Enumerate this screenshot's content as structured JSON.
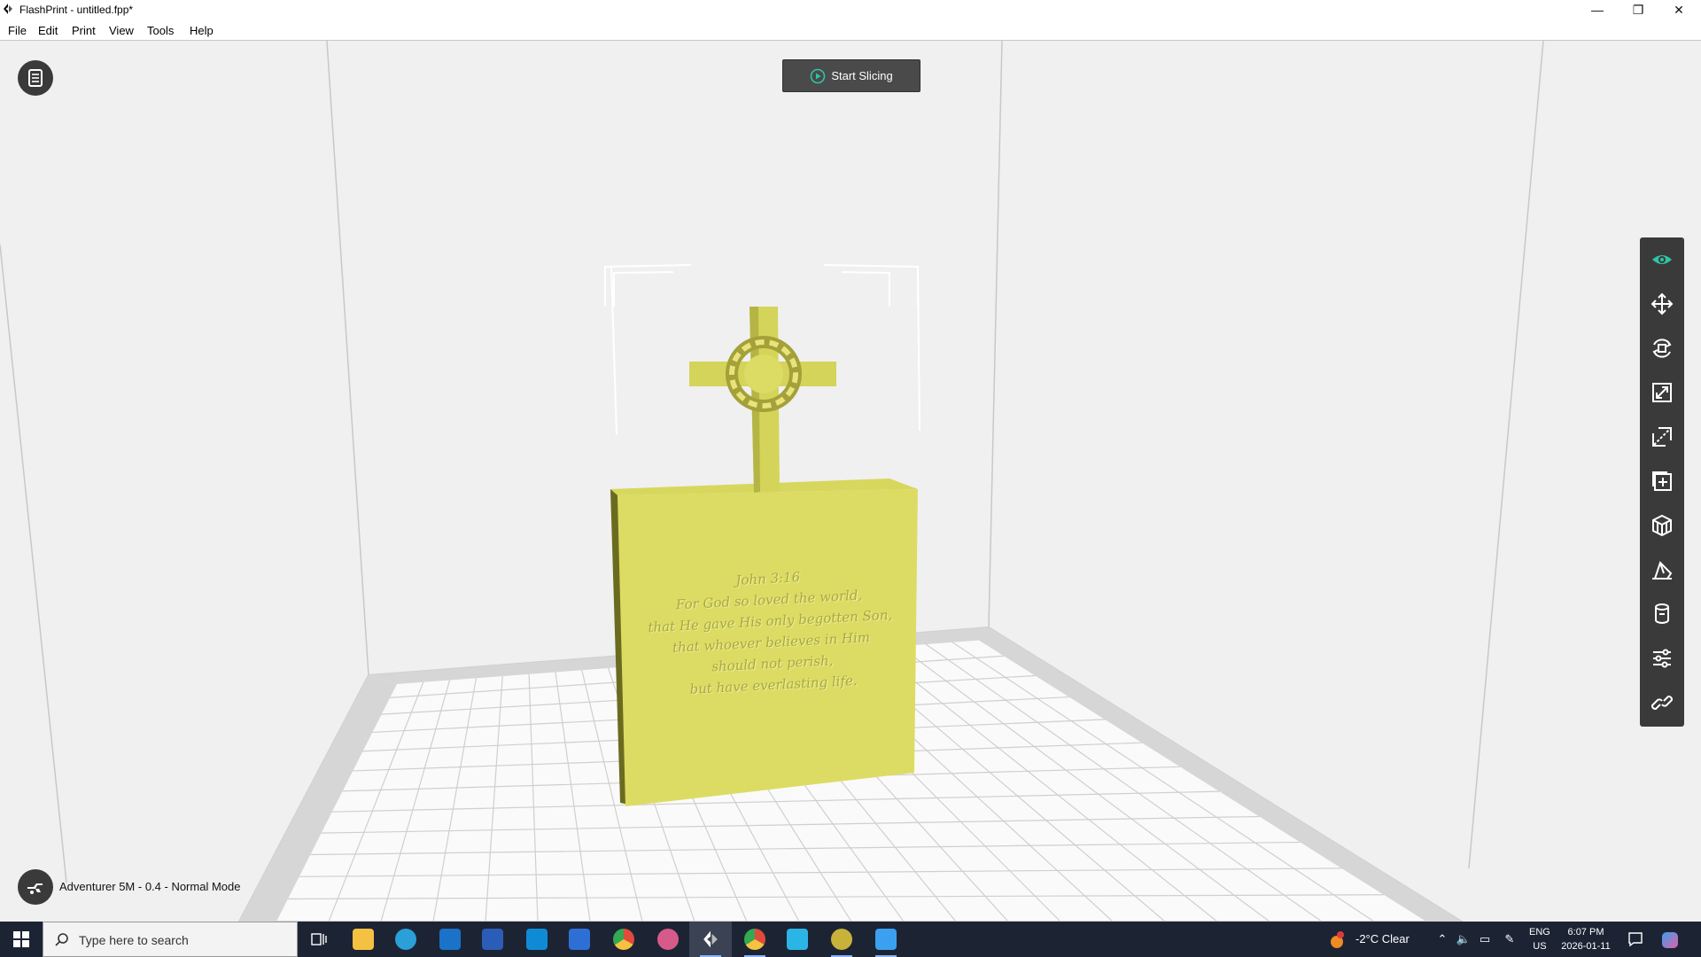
{
  "window": {
    "title": "FlashPrint - untitled.fpp*",
    "min_glyph": "—",
    "max_glyph": "❐",
    "close_glyph": "✕"
  },
  "menu": {
    "items": [
      "File",
      "Edit",
      "Print",
      "View",
      "Tools",
      "Help"
    ]
  },
  "viewport": {
    "slice_button_label": "Start Slicing",
    "doc_button_icon": "document-list-icon",
    "model_color": "#dcdc64",
    "bed_grid_color": "#c8c8c8",
    "engraved_text": [
      "John 3:16",
      "For God so loved the world,",
      "that He gave His only begotten Son,",
      "that whoever believes in Him",
      "should not perish,",
      "but have everlasting life."
    ]
  },
  "toolbar": {
    "active_color": "#2ec4a6",
    "tools": [
      {
        "name": "view",
        "icon": "eye-icon",
        "active": true
      },
      {
        "name": "move",
        "icon": "move-arrows-icon",
        "active": false
      },
      {
        "name": "rotate",
        "icon": "rotate-icon",
        "active": false
      },
      {
        "name": "scale",
        "icon": "scale-icon",
        "active": false
      },
      {
        "name": "cut",
        "icon": "cut-icon",
        "active": false
      },
      {
        "name": "add",
        "icon": "add-icon",
        "active": false
      },
      {
        "name": "supports",
        "icon": "supports-icon",
        "active": false
      },
      {
        "name": "lay-flat",
        "icon": "lay-flat-icon",
        "active": false
      },
      {
        "name": "extruder",
        "icon": "extruder-icon",
        "active": false
      },
      {
        "name": "settings",
        "icon": "sliders-icon",
        "active": false
      },
      {
        "name": "connect",
        "icon": "link-icon",
        "active": false
      }
    ]
  },
  "status": {
    "printer_label": "Adventurer 5M - 0.4 - Normal Mode",
    "printer_icon": "printer-icon"
  },
  "taskbar": {
    "search_placeholder": "Type here to search",
    "apps": [
      {
        "name": "task-view",
        "icon": "task-view-icon",
        "color": "#ffffff"
      },
      {
        "name": "file-explorer",
        "icon": "folder-icon",
        "color": "#f4c142"
      },
      {
        "name": "edge",
        "icon": "edge-icon",
        "color": "#2a9fd8"
      },
      {
        "name": "outlook",
        "icon": "outlook-icon",
        "color": "#1a73c8"
      },
      {
        "name": "word",
        "icon": "word-icon",
        "color": "#2b5cb8"
      },
      {
        "name": "store-app",
        "icon": "store-icon",
        "color": "#0f8bd6"
      },
      {
        "name": "microsoft-store",
        "icon": "microsoft-store-icon",
        "color": "#2e6fd6"
      },
      {
        "name": "chrome",
        "icon": "chrome-icon",
        "color": "#e04b3c"
      },
      {
        "name": "paint-app",
        "icon": "paint-icon",
        "color": "#d65b8a"
      },
      {
        "name": "flashprint",
        "icon": "flashprint-icon",
        "color": "#ffffff"
      },
      {
        "name": "chrome-profile",
        "icon": "chrome-profile-icon",
        "color": "#e04b3c"
      },
      {
        "name": "app-n",
        "icon": "n-app-icon",
        "color": "#2bb5e6"
      },
      {
        "name": "globe-app",
        "icon": "globe-icon",
        "color": "#c9b23a"
      },
      {
        "name": "photos-app",
        "icon": "photos-icon",
        "color": "#3ba0f0"
      }
    ],
    "weather": "-2°C  Clear",
    "lang_line1": "ENG",
    "lang_line2": "US",
    "time": "6:07 PM",
    "date": "2026-01-11"
  }
}
